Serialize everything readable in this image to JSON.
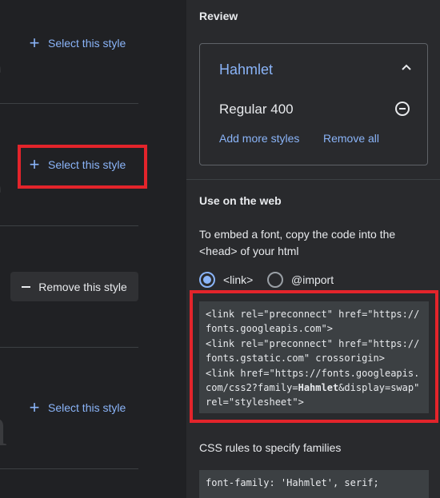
{
  "left_panel": {
    "style_rows": [
      {
        "button_label": "Select this style"
      },
      {
        "button_label": "Select this style"
      },
      {
        "button_label": "Remove this style"
      },
      {
        "button_label": "Select this style"
      }
    ]
  },
  "review": {
    "heading": "Review",
    "font_family": "Hahmlet",
    "selected_style": "Regular 400",
    "add_more_label": "Add more styles",
    "remove_all_label": "Remove all"
  },
  "web": {
    "heading": "Use on the web",
    "description": "To embed a font, copy the code into the <head> of your html",
    "embed_options": [
      {
        "label": "<link>",
        "checked": true
      },
      {
        "label": "@import",
        "checked": false
      }
    ],
    "code_lines": [
      "<link rel=\"preconnect\" href=\"https://",
      "fonts.googleapis.com\">",
      "<link rel=\"preconnect\" href=\"https://",
      "fonts.gstatic.com\" crossorigin>",
      "<link href=\"https://fonts.googleapis.",
      "com/css2?family=",
      "Hahmlet",
      "&display=swap\"",
      "rel=\"stylesheet\">"
    ],
    "css_heading": "CSS rules to specify families",
    "css_rule": "font-family: 'Hahmlet', serif;"
  },
  "colors": {
    "accent": "#8ab4f8",
    "highlight_box": "#e3242b",
    "background": "#202124",
    "panel": "#292a2d",
    "code_bg": "#3c4043"
  }
}
